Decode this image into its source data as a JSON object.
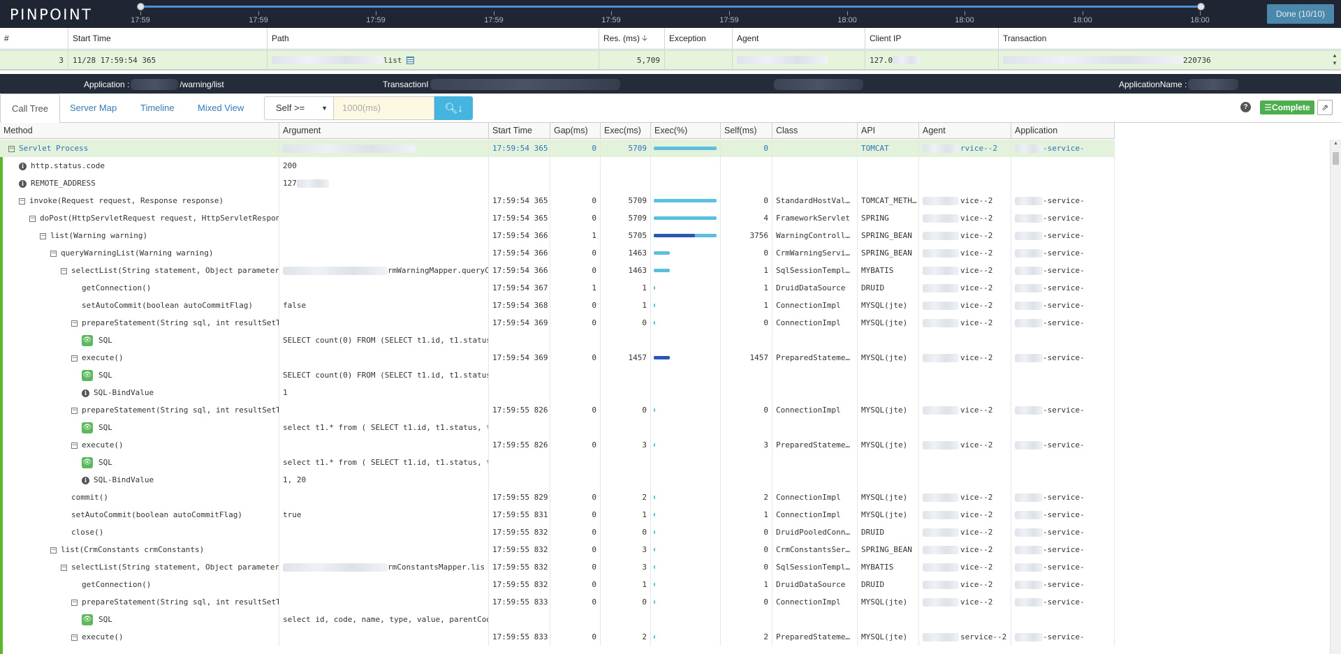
{
  "app": {
    "logo": "PINPOINT",
    "done_label": "Done (10/10)"
  },
  "timeline": {
    "labels": [
      "17:59",
      "17:59",
      "17:59",
      "17:59",
      "17:59",
      "17:59",
      "18:00",
      "18:00",
      "18:00",
      "18:00"
    ]
  },
  "tx_table": {
    "columns": [
      "#",
      "Start Time",
      "Path",
      "Res. (ms)",
      "Exception",
      "Agent",
      "Client IP",
      "Transaction"
    ],
    "sort_indicator": "🡣",
    "row": {
      "num": "3",
      "start_time": "11/28 17:59:54 365",
      "path_suffix": "list",
      "res": "5,709",
      "exception": "",
      "client_ip": "127.0",
      "transaction_suffix": "220736"
    }
  },
  "info_bar": {
    "application_label": "Application :",
    "application_value": "/warning/list",
    "transaction_label": "TransactionI",
    "appname_label": "ApplicationName :"
  },
  "tabs": [
    "Call Tree",
    "Server Map",
    "Timeline",
    "Mixed View"
  ],
  "filter": {
    "select_value": "Self >=",
    "input_placeholder": "1000(ms)",
    "help": "?",
    "complete_label": "☰Complete",
    "expand_icon": "⇗"
  },
  "grid": {
    "columns": [
      "Method",
      "Argument",
      "Start Time",
      "Gap(ms)",
      "Exec(ms)",
      "Exec(%)",
      "Self(ms)",
      "Class",
      "API",
      "Agent",
      "Application"
    ],
    "rows": [
      {
        "level": 0,
        "kind": "toggle",
        "method": "Servlet Process",
        "arg": "",
        "start": "17:59:54 365",
        "gap": "0",
        "exec": "5709",
        "pct": 100,
        "selfpct": 0,
        "self": "0",
        "cls": "",
        "api": "TOMCAT",
        "agent": "rvice--2",
        "app": "-service-",
        "root": true
      },
      {
        "level": 1,
        "kind": "info",
        "method": "http.status.code",
        "arg": "200",
        "start": "",
        "gap": "",
        "exec": "",
        "pct": null,
        "self": "",
        "cls": "",
        "api": "",
        "agent": "",
        "app": ""
      },
      {
        "level": 1,
        "kind": "info",
        "method": "REMOTE_ADDRESS",
        "arg": "127",
        "start": "",
        "gap": "",
        "exec": "",
        "pct": null,
        "self": "",
        "cls": "",
        "api": "",
        "agent": "",
        "app": ""
      },
      {
        "level": 1,
        "kind": "toggle",
        "method": "invoke(Request request, Response response)",
        "arg": "",
        "start": "17:59:54 365",
        "gap": "0",
        "exec": "5709",
        "pct": 100,
        "selfpct": 0,
        "self": "0",
        "cls": "StandardHostVal…",
        "api": "TOMCAT_METH…",
        "agent": "vice--2",
        "app": "-service-"
      },
      {
        "level": 2,
        "kind": "toggle",
        "method": "doPost(HttpServletRequest request, HttpServletResponse",
        "arg": "",
        "start": "17:59:54 365",
        "gap": "0",
        "exec": "5709",
        "pct": 100,
        "selfpct": 0,
        "self": "4",
        "cls": "FrameworkServlet",
        "api": "SPRING",
        "agent": "vice--2",
        "app": "-service-"
      },
      {
        "level": 3,
        "kind": "toggle",
        "method": "list(Warning warning)",
        "arg": "",
        "start": "17:59:54 366",
        "gap": "1",
        "exec": "5705",
        "pct": 100,
        "selfpct": 66,
        "self": "3756",
        "cls": "WarningControll…",
        "api": "SPRING_BEAN",
        "agent": "vice--2",
        "app": "-service-"
      },
      {
        "level": 4,
        "kind": "toggle",
        "method": "queryWarningList(Warning warning)",
        "arg": "",
        "start": "17:59:54 366",
        "gap": "0",
        "exec": "1463",
        "pct": 26,
        "selfpct": 0,
        "self": "0",
        "cls": "CrmWarningServi…",
        "api": "SPRING_BEAN",
        "agent": "vice--2",
        "app": "-service-"
      },
      {
        "level": 5,
        "kind": "toggle",
        "method": "selectList(String statement, Object parameter",
        "arg": "rmWarningMapper.queryC",
        "start": "17:59:54 366",
        "gap": "0",
        "exec": "1463",
        "pct": 26,
        "selfpct": 0,
        "self": "1",
        "cls": "SqlSessionTempl…",
        "api": "MYBATIS",
        "agent": "vice--2",
        "app": "-service-"
      },
      {
        "level": 6,
        "kind": "none",
        "method": "getConnection()",
        "arg": "",
        "start": "17:59:54 367",
        "gap": "1",
        "exec": "1",
        "pct": 1,
        "selfpct": 0,
        "self": "1",
        "cls": "DruidDataSource",
        "api": "DRUID",
        "agent": "vice--2",
        "app": "-service-"
      },
      {
        "level": 6,
        "kind": "none",
        "method": "setAutoCommit(boolean autoCommitFlag)",
        "arg": "false",
        "start": "17:59:54 368",
        "gap": "0",
        "exec": "1",
        "pct": 1,
        "selfpct": 0,
        "self": "1",
        "cls": "ConnectionImpl",
        "api": "MYSQL(jte)",
        "agent": "vice--2",
        "app": "-service-"
      },
      {
        "level": 6,
        "kind": "toggle",
        "method": "prepareStatement(String sql, int resultSetT",
        "arg": "",
        "start": "17:59:54 369",
        "gap": "0",
        "exec": "0",
        "pct": 1,
        "selfpct": 0,
        "self": "0",
        "cls": "ConnectionImpl",
        "api": "MYSQL(jte)",
        "agent": "vice--2",
        "app": "-service-"
      },
      {
        "level": 7,
        "kind": "eye",
        "method": "SQL",
        "arg": "SELECT count(0) FROM (SELECT t1.id, t1.status",
        "start": "",
        "gap": "",
        "exec": "",
        "pct": null,
        "self": "",
        "cls": "",
        "api": "",
        "agent": "",
        "app": ""
      },
      {
        "level": 6,
        "kind": "toggle",
        "method": "execute()",
        "arg": "",
        "start": "17:59:54 369",
        "gap": "0",
        "exec": "1457",
        "pct": 26,
        "selfpct": 26,
        "self": "1457",
        "cls": "PreparedStateme…",
        "api": "MYSQL(jte)",
        "agent": "vice--2",
        "app": "-service-"
      },
      {
        "level": 7,
        "kind": "eye",
        "method": "SQL",
        "arg": "SELECT count(0) FROM (SELECT t1.id, t1.status",
        "start": "",
        "gap": "",
        "exec": "",
        "pct": null,
        "self": "",
        "cls": "",
        "api": "",
        "agent": "",
        "app": ""
      },
      {
        "level": 7,
        "kind": "info",
        "method": "SQL-BindValue",
        "arg": "1",
        "start": "",
        "gap": "",
        "exec": "",
        "pct": null,
        "self": "",
        "cls": "",
        "api": "",
        "agent": "",
        "app": ""
      },
      {
        "level": 6,
        "kind": "toggle",
        "method": "prepareStatement(String sql, int resultSetT",
        "arg": "",
        "start": "17:59:55 826",
        "gap": "0",
        "exec": "0",
        "pct": 1,
        "selfpct": 0,
        "self": "0",
        "cls": "ConnectionImpl",
        "api": "MYSQL(jte)",
        "agent": "vice--2",
        "app": "-service-"
      },
      {
        "level": 7,
        "kind": "eye",
        "method": "SQL",
        "arg": "select t1.* from ( SELECT t1.id, t1.status, t",
        "start": "",
        "gap": "",
        "exec": "",
        "pct": null,
        "self": "",
        "cls": "",
        "api": "",
        "agent": "",
        "app": ""
      },
      {
        "level": 6,
        "kind": "toggle",
        "method": "execute()",
        "arg": "",
        "start": "17:59:55 826",
        "gap": "0",
        "exec": "3",
        "pct": 1,
        "selfpct": 0,
        "self": "3",
        "cls": "PreparedStateme…",
        "api": "MYSQL(jte)",
        "agent": "vice--2",
        "app": "-service-"
      },
      {
        "level": 7,
        "kind": "eye",
        "method": "SQL",
        "arg": "select t1.* from ( SELECT t1.id, t1.status, t",
        "start": "",
        "gap": "",
        "exec": "",
        "pct": null,
        "self": "",
        "cls": "",
        "api": "",
        "agent": "",
        "app": ""
      },
      {
        "level": 7,
        "kind": "info",
        "method": "SQL-BindValue",
        "arg": "1, 20",
        "start": "",
        "gap": "",
        "exec": "",
        "pct": null,
        "self": "",
        "cls": "",
        "api": "",
        "agent": "",
        "app": ""
      },
      {
        "level": 5,
        "kind": "none",
        "method": "commit()",
        "arg": "",
        "start": "17:59:55 829",
        "gap": "0",
        "exec": "2",
        "pct": 1,
        "selfpct": 0,
        "self": "2",
        "cls": "ConnectionImpl",
        "api": "MYSQL(jte)",
        "agent": "vice--2",
        "app": "-service-"
      },
      {
        "level": 5,
        "kind": "none",
        "method": "setAutoCommit(boolean autoCommitFlag)",
        "arg": "true",
        "start": "17:59:55 831",
        "gap": "0",
        "exec": "1",
        "pct": 1,
        "selfpct": 0,
        "self": "1",
        "cls": "ConnectionImpl",
        "api": "MYSQL(jte)",
        "agent": "vice--2",
        "app": "-service-"
      },
      {
        "level": 5,
        "kind": "none",
        "method": "close()",
        "arg": "",
        "start": "17:59:55 832",
        "gap": "0",
        "exec": "0",
        "pct": 1,
        "selfpct": 0,
        "self": "0",
        "cls": "DruidPooledConn…",
        "api": "DRUID",
        "agent": "vice--2",
        "app": "-service-"
      },
      {
        "level": 4,
        "kind": "toggle",
        "method": "list(CrmConstants crmConstants)",
        "arg": "",
        "start": "17:59:55 832",
        "gap": "0",
        "exec": "3",
        "pct": 1,
        "selfpct": 0,
        "self": "0",
        "cls": "CrmConstantsSer…",
        "api": "SPRING_BEAN",
        "agent": "vice--2",
        "app": "-service-"
      },
      {
        "level": 5,
        "kind": "toggle",
        "method": "selectList(String statement, Object parameter",
        "arg": "rmConstantsMapper.lis",
        "start": "17:59:55 832",
        "gap": "0",
        "exec": "3",
        "pct": 1,
        "selfpct": 0,
        "self": "0",
        "cls": "SqlSessionTempl…",
        "api": "MYBATIS",
        "agent": "vice--2",
        "app": "-service-"
      },
      {
        "level": 6,
        "kind": "none",
        "method": "getConnection()",
        "arg": "",
        "start": "17:59:55 832",
        "gap": "0",
        "exec": "1",
        "pct": 1,
        "selfpct": 0,
        "self": "1",
        "cls": "DruidDataSource",
        "api": "DRUID",
        "agent": "vice--2",
        "app": "-service-"
      },
      {
        "level": 6,
        "kind": "toggle",
        "method": "prepareStatement(String sql, int resultSetT",
        "arg": "",
        "start": "17:59:55 833",
        "gap": "0",
        "exec": "0",
        "pct": 1,
        "selfpct": 0,
        "self": "0",
        "cls": "ConnectionImpl",
        "api": "MYSQL(jte)",
        "agent": "vice--2",
        "app": "-service-"
      },
      {
        "level": 7,
        "kind": "eye",
        "method": "SQL",
        "arg": "select id, code, name, type, value, parentCod",
        "start": "",
        "gap": "",
        "exec": "",
        "pct": null,
        "self": "",
        "cls": "",
        "api": "",
        "agent": "",
        "app": ""
      },
      {
        "level": 6,
        "kind": "toggle",
        "method": "execute()",
        "arg": "",
        "start": "17:59:55 833",
        "gap": "0",
        "exec": "2",
        "pct": 1,
        "selfpct": 0,
        "self": "2",
        "cls": "PreparedStateme…",
        "api": "MYSQL(jte)",
        "agent": "service--2",
        "app": "-service-"
      }
    ]
  },
  "colors": {
    "topbar": "#1f2532",
    "accent": "#337ab7",
    "bar_total": "#5bc0de",
    "bar_self": "#2a56b8",
    "row_highlight": "#e3f2da",
    "complete": "#4cae4c"
  }
}
